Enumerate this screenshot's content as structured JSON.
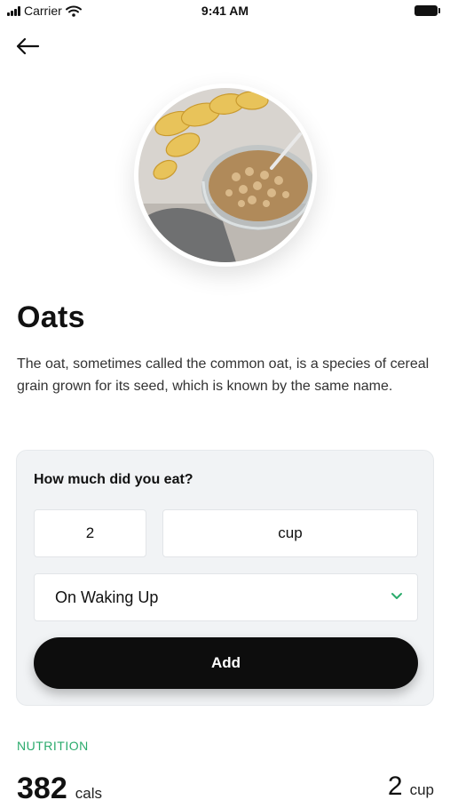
{
  "status_bar": {
    "carrier": "Carrier",
    "time": "9:41 AM"
  },
  "header": {
    "back_icon": "arrow-left-icon"
  },
  "food": {
    "image_icon": "oats-bowl-photo",
    "name": "Oats",
    "description": "The oat, sometimes called the common oat, is a species of cereal grain grown for its seed, which is known by the same name."
  },
  "intake_form": {
    "question": "How much did you eat?",
    "quantity_value": "2",
    "unit_value": "cup",
    "meal_time_value": "On Waking Up",
    "add_label": "Add",
    "chevron_color": "#2bab6c"
  },
  "nutrition": {
    "section_label": "NUTRITION",
    "calories_value": "382",
    "calories_unit": "cals",
    "serving_value": "2",
    "serving_unit": "cup"
  },
  "colors": {
    "accent_green": "#2bab6c",
    "button_black": "#0d0d0d",
    "card_bg": "#f1f3f5"
  }
}
